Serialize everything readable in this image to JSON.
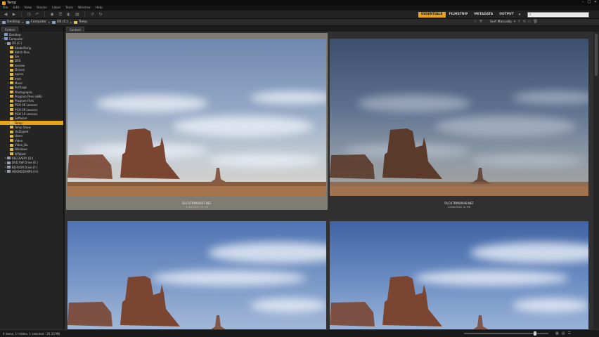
{
  "window": {
    "title": "Temp"
  },
  "menu": [
    "File",
    "Edit",
    "View",
    "Stacks",
    "Label",
    "Tools",
    "Window",
    "Help"
  ],
  "workspaces": [
    {
      "label": "ESSENTIALS",
      "active": true
    },
    {
      "label": "FILMSTRIP",
      "active": false
    },
    {
      "label": "METADATA",
      "active": false
    },
    {
      "label": "OUTPUT",
      "active": false
    }
  ],
  "search": {
    "placeholder": ""
  },
  "path": [
    "Desktop",
    "Computer",
    "OS (C:)",
    "Temp"
  ],
  "sort": {
    "label": "Sort Manually"
  },
  "left_panel": {
    "tab": "Folders"
  },
  "content_panel": {
    "tab": "Content"
  },
  "tree": [
    {
      "label": "Desktop",
      "indent": 0,
      "icon": "computer",
      "toggle": ""
    },
    {
      "label": "Computer",
      "indent": 0,
      "icon": "computer",
      "toggle": "▾"
    },
    {
      "label": "OS (C:)",
      "indent": 1,
      "icon": "drive",
      "toggle": "▾"
    },
    {
      "label": "AdobeTemp",
      "indent": 2,
      "icon": "folder",
      "toggle": ""
    },
    {
      "label": "Batch files",
      "indent": 2,
      "icon": "folder",
      "toggle": ""
    },
    {
      "label": "bin",
      "indent": 2,
      "icon": "folder",
      "toggle": ""
    },
    {
      "label": "DRS",
      "indent": 2,
      "icon": "folder",
      "toggle": ""
    },
    {
      "label": "dnview",
      "indent": 2,
      "icon": "folder",
      "toggle": ""
    },
    {
      "label": "Drivers",
      "indent": 2,
      "icon": "folder",
      "toggle": ""
    },
    {
      "label": "epson",
      "indent": 2,
      "icon": "folder",
      "toggle": ""
    },
    {
      "label": "Intel",
      "indent": 2,
      "icon": "folder",
      "toggle": ""
    },
    {
      "label": "Music",
      "indent": 2,
      "icon": "folder",
      "toggle": "▸"
    },
    {
      "label": "PerfLogs",
      "indent": 2,
      "icon": "folder",
      "toggle": ""
    },
    {
      "label": "Photographs",
      "indent": 2,
      "icon": "folder",
      "toggle": ""
    },
    {
      "label": "Program Files (x86)",
      "indent": 2,
      "icon": "folder",
      "toggle": ""
    },
    {
      "label": "Program Files",
      "indent": 2,
      "icon": "folder",
      "toggle": ""
    },
    {
      "label": "PSXI 06 Lessons",
      "indent": 2,
      "icon": "folder",
      "toggle": ""
    },
    {
      "label": "PSXI 09 Lessons",
      "indent": 2,
      "icon": "folder",
      "toggle": ""
    },
    {
      "label": "PSXI 10 Lessons",
      "indent": 2,
      "icon": "folder",
      "toggle": ""
    },
    {
      "label": "Software",
      "indent": 2,
      "icon": "folder",
      "toggle": ""
    },
    {
      "label": "Temp",
      "indent": 2,
      "icon": "folder",
      "toggle": "",
      "selected": true
    },
    {
      "label": "Temp Show",
      "indent": 2,
      "icon": "folder",
      "toggle": ""
    },
    {
      "label": "UnZipped",
      "indent": 2,
      "icon": "folder",
      "toggle": ""
    },
    {
      "label": "Users",
      "indent": 2,
      "icon": "folder",
      "toggle": ""
    },
    {
      "label": "Video",
      "indent": 2,
      "icon": "folder",
      "toggle": ""
    },
    {
      "label": "Video_Bu",
      "indent": 2,
      "icon": "folder",
      "toggle": ""
    },
    {
      "label": "Windows",
      "indent": 2,
      "icon": "folder",
      "toggle": ""
    },
    {
      "label": "WTablet",
      "indent": 2,
      "icon": "folder",
      "toggle": ""
    },
    {
      "label": "RECOVERY (D:)",
      "indent": 1,
      "icon": "drive",
      "toggle": "▸"
    },
    {
      "label": "DVD RW Drive (E:)",
      "indent": 1,
      "icon": "drive",
      "toggle": "▸"
    },
    {
      "label": "BD-ROM Drive (F:)",
      "indent": 1,
      "icon": "drive",
      "toggle": "▸"
    },
    {
      "label": "HOOKEDUMPS (H:)",
      "indent": 1,
      "icon": "drive",
      "toggle": "▸"
    }
  ],
  "thumbnails": [
    {
      "filename": "DLCUTRM00947.NEF",
      "meta": "4288x2848 18 MB",
      "selected": true
    },
    {
      "filename": "DLCUTRM00948.NEF",
      "meta": "4288x2848 18 MB",
      "selected": false
    },
    {
      "filename": "",
      "meta": "",
      "selected": false
    },
    {
      "filename": "",
      "meta": "",
      "selected": false
    }
  ],
  "status": {
    "text": "4 items, 1 hidden, 1 selected - 26.33 MB"
  },
  "zoom": {
    "value": 0.85
  }
}
